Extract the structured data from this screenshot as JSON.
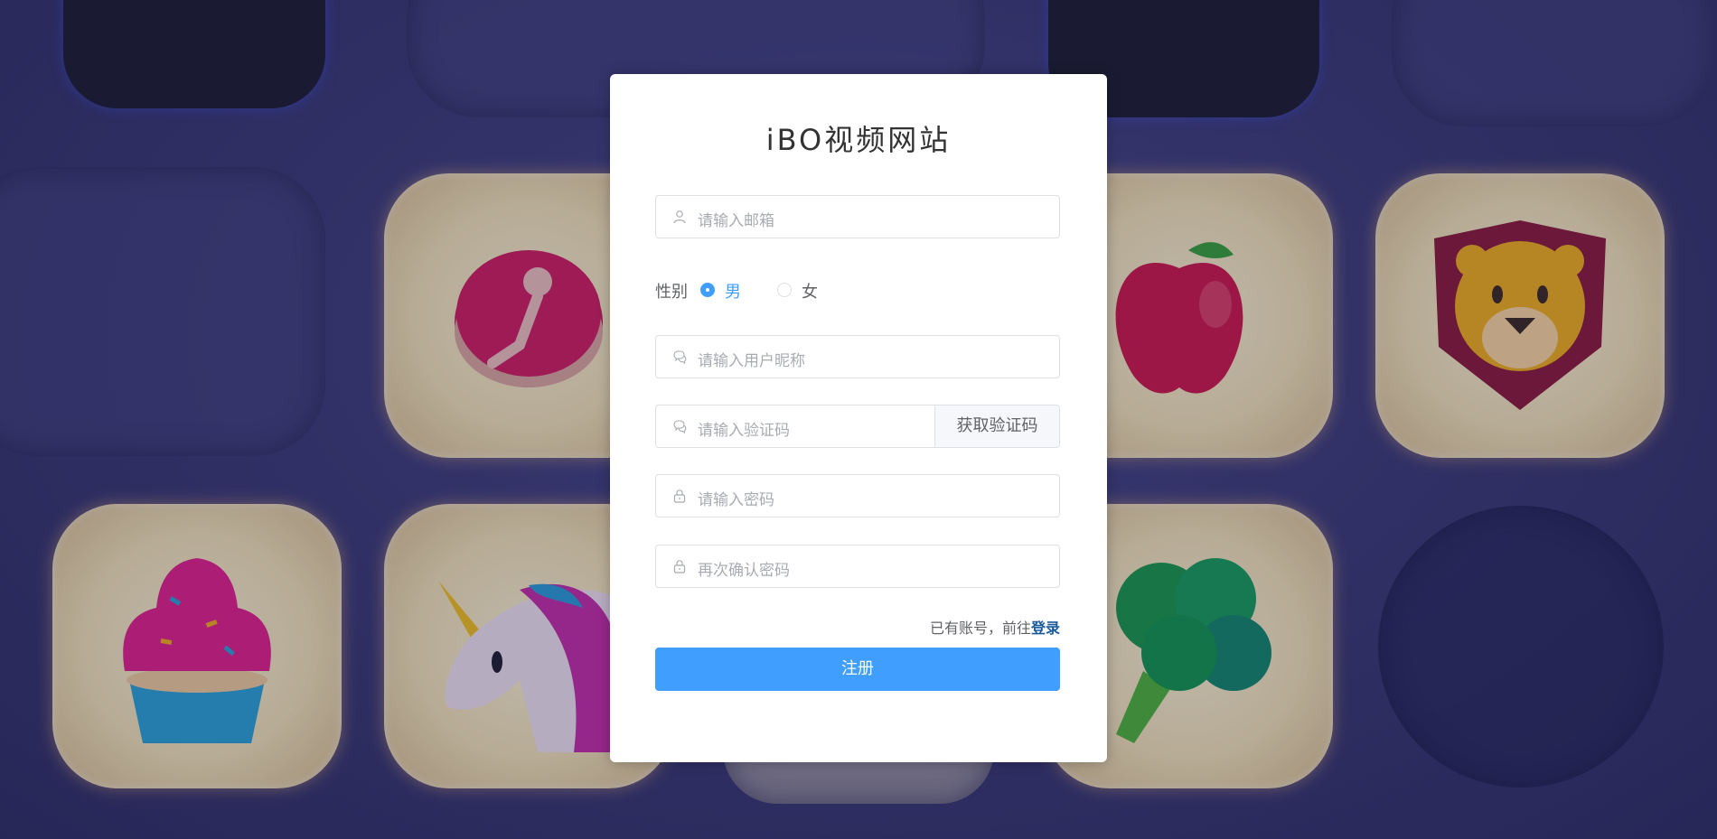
{
  "title": "iBO视频网站",
  "form": {
    "email_placeholder": "请输入邮箱",
    "gender_label": "性别",
    "gender_options": [
      "男",
      "女"
    ],
    "gender_selected": "男",
    "nickname_placeholder": "请输入用户昵称",
    "code_placeholder": "请输入验证码",
    "get_code_label": "获取验证码",
    "password_placeholder": "请输入密码",
    "confirm_password_placeholder": "再次确认密码",
    "login_hint": "已有账号，前往",
    "login_link": "登录",
    "submit_label": "注册"
  },
  "colors": {
    "primary": "#409eff",
    "link": "#1a5a9c",
    "placeholder": "#a8abb2",
    "border": "#dcdfe6"
  },
  "icons": {
    "email": "user-icon",
    "nickname": "chat-icon",
    "code": "chat-icon",
    "password": "lock-icon",
    "confirm_password": "lock-icon"
  }
}
